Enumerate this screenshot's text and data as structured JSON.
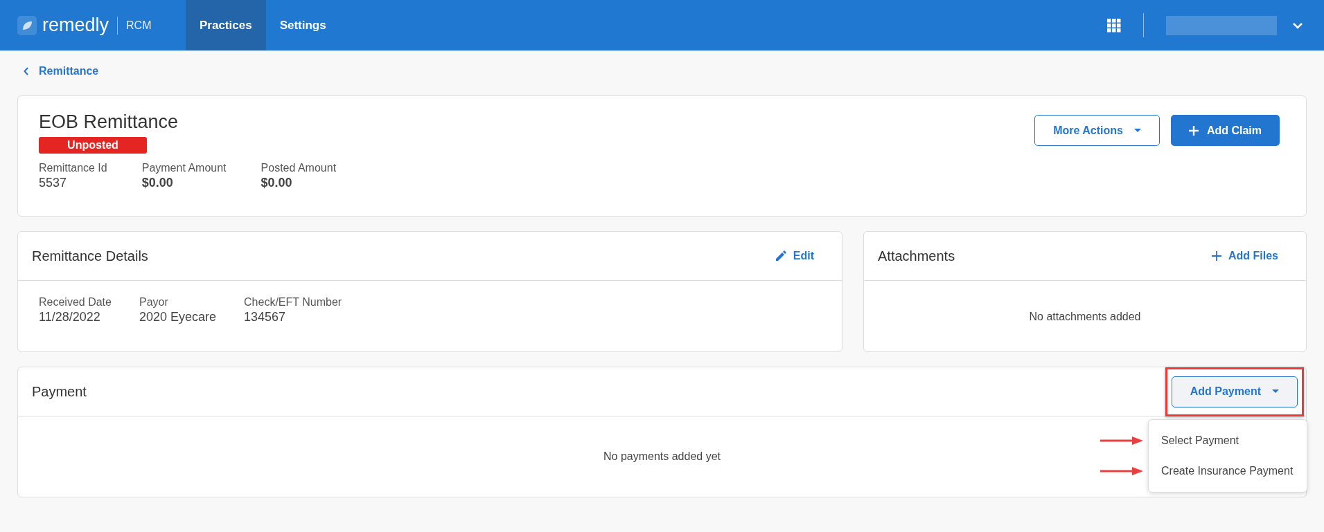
{
  "header": {
    "logo": {
      "name": "remedly",
      "product": "RCM"
    },
    "nav": [
      {
        "label": "Practices",
        "selected": true
      },
      {
        "label": "Settings",
        "selected": false
      }
    ]
  },
  "breadcrumb": {
    "label": "Remittance"
  },
  "summary": {
    "title": "EOB Remittance",
    "status": "Unposted",
    "fields": [
      {
        "label": "Remittance Id",
        "value": "5537",
        "kind": "plain"
      },
      {
        "label": "Payment Amount",
        "value": "$0.00",
        "kind": "bold"
      },
      {
        "label": "Posted Amount",
        "value": "$0.00",
        "kind": "bold"
      }
    ],
    "actions": [
      {
        "label": "More Actions",
        "kind": "dropdown"
      },
      {
        "label": "Add Claim",
        "kind": "primary"
      }
    ]
  },
  "remittance_details": {
    "title": "Remittance Details",
    "action": "Edit",
    "fields": [
      {
        "label": "Received Date",
        "value": "11/28/2022"
      },
      {
        "label": "Payor",
        "value": "2020 Eyecare"
      },
      {
        "label": "Check/EFT Number",
        "value": "134567"
      }
    ]
  },
  "attachments": {
    "title": "Attachments",
    "action": "Add Files",
    "empty_message": "No attachments added"
  },
  "payment": {
    "title": "Payment",
    "button": {
      "label": "Add Payment",
      "expanded": true,
      "highlighted": true
    },
    "empty_message": "No payments added yet",
    "menu": [
      {
        "label": "Select Payment",
        "annotated": true
      },
      {
        "label": "Create Insurance Payment",
        "annotated": true
      }
    ]
  }
}
